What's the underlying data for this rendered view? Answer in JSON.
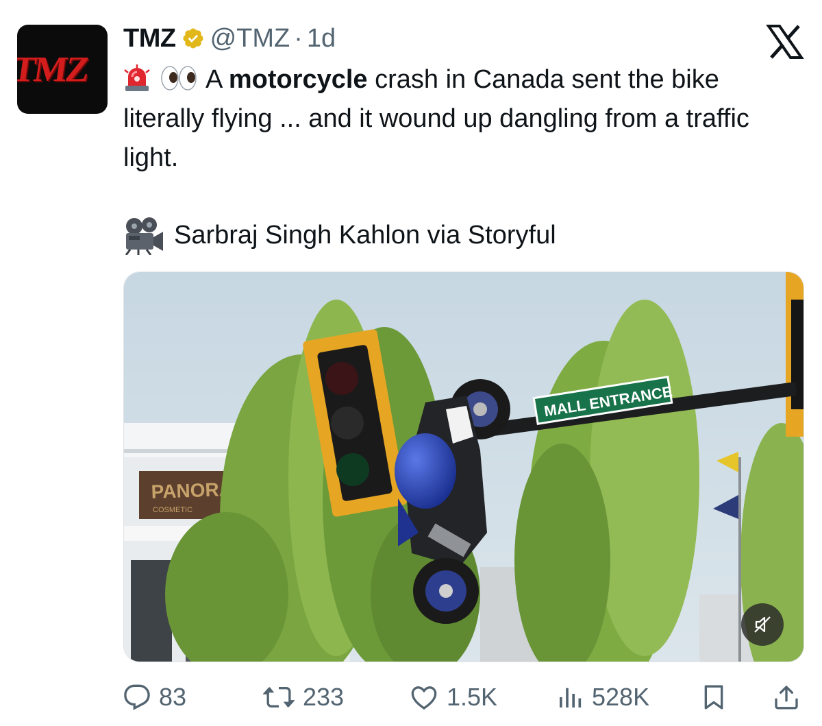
{
  "tweet": {
    "display_name": "TMZ",
    "avatar_text": "TMZ",
    "handle": "@TMZ",
    "separator": "·",
    "time": "1d",
    "text": {
      "before_bold": "A ",
      "bold": "motorcycle",
      "after_bold": " crash in Canada sent the bike literally flying ... and it wound up dangling from a traffic light."
    },
    "emojis": [
      "siren-emoji",
      "eyes-emoji"
    ],
    "credit": "Sarbraj Singh Kahlon via Storyful",
    "media": {
      "sign_text": "MALL ENTRANCE",
      "building_sign": "PANORAMA",
      "building_sub": "COSMETIC"
    }
  },
  "actions": {
    "replies": "83",
    "reposts": "233",
    "likes": "1.5K",
    "views": "528K"
  },
  "colors": {
    "text": "#0f1419",
    "muted": "#536471",
    "verified_gold": "#e2b719",
    "tmz_red": "#d31d1d"
  },
  "icons": [
    "x-logo",
    "verified-badge-icon",
    "camera-icon",
    "mute-icon",
    "reply-icon",
    "repost-icon",
    "like-icon",
    "views-icon",
    "bookmark-icon",
    "share-icon"
  ]
}
